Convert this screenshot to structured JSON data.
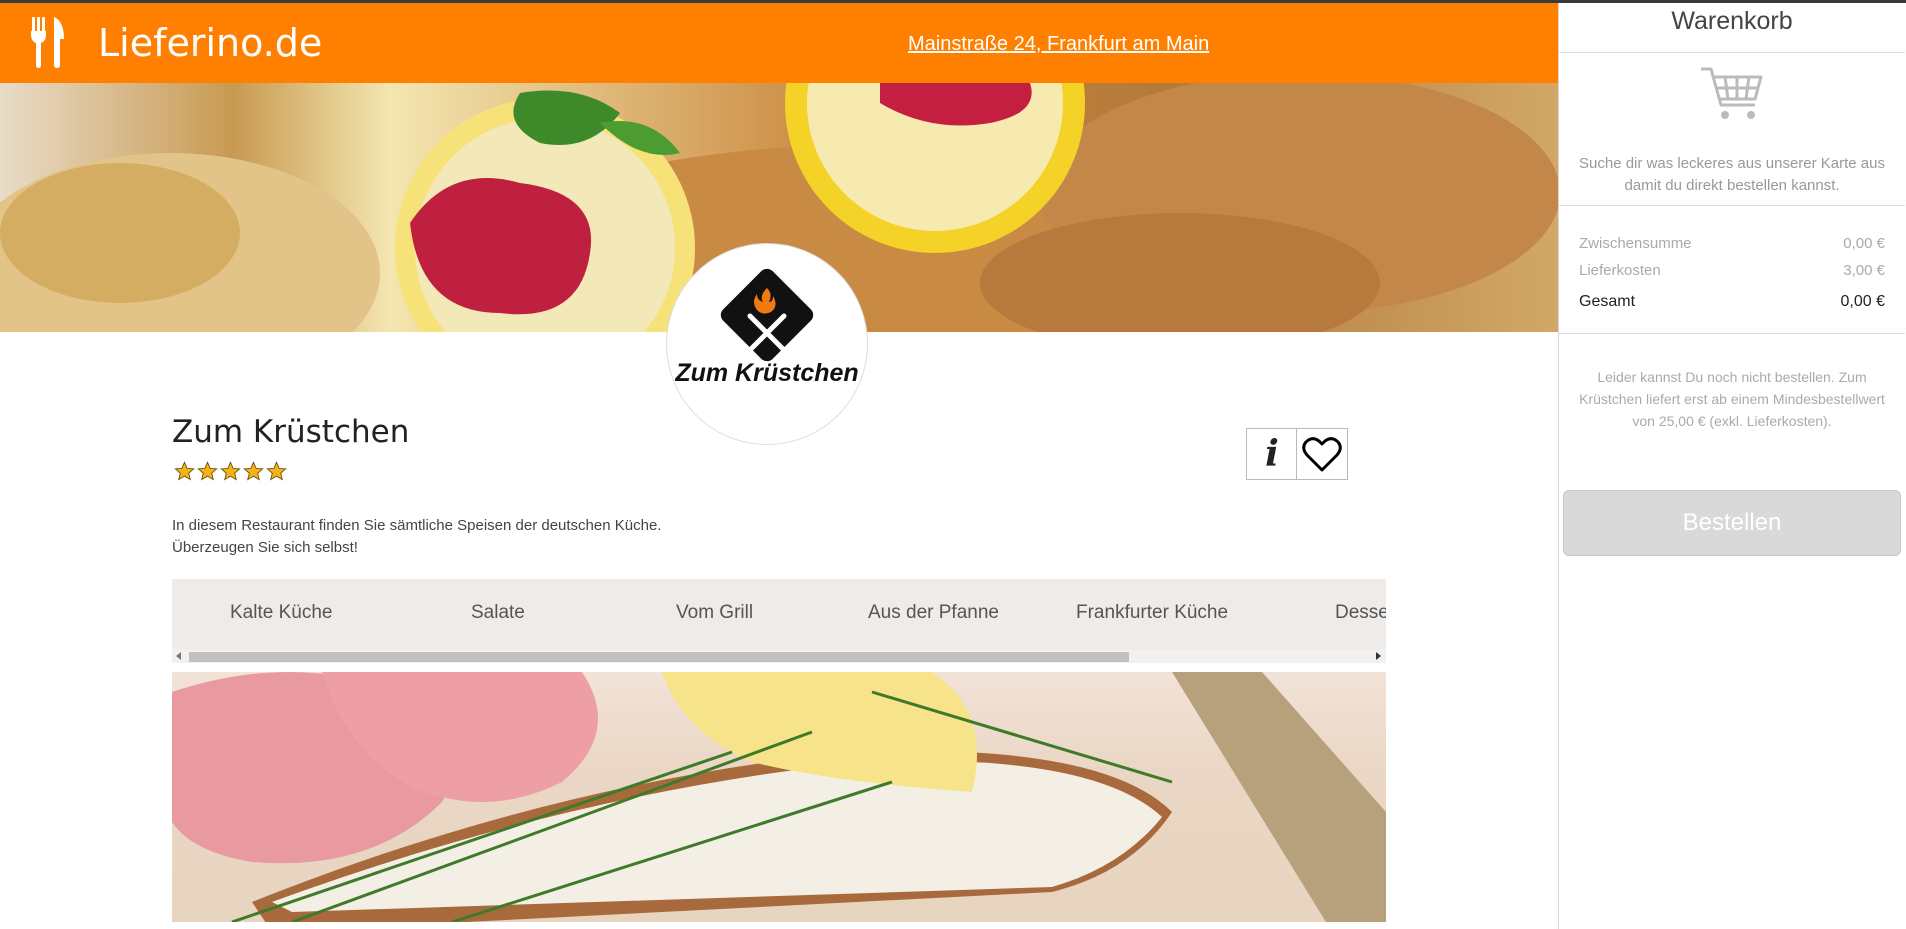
{
  "header": {
    "site_name": "Lieferino.de",
    "address": "Mainstraße 24, Frankfurt am Main",
    "brand_color": "#ff8000"
  },
  "restaurant": {
    "logo_text": "Zum Krüstchen",
    "name": "Zum Krüstchen",
    "rating": 5,
    "rating_max": 5,
    "description_line1": "In diesem Restaurant finden Sie sämtliche Speisen der deutschen Küche.",
    "description_line2": "Überzeugen Sie sich selbst!",
    "info_icon": "info-icon",
    "info_label": "i",
    "favorite_icon": "heart-icon"
  },
  "categories": [
    {
      "label": "Kalte Küche"
    },
    {
      "label": "Salate"
    },
    {
      "label": "Vom Grill"
    },
    {
      "label": "Aus der Pfanne"
    },
    {
      "label": "Frankfurter Küche"
    },
    {
      "label": "Desse"
    }
  ],
  "cart": {
    "title": "Warenkorb",
    "empty_hint": "Suche dir was leckeres aus unserer Karte aus damit du direkt bestellen kannst.",
    "subtotal_label": "Zwischensumme",
    "subtotal_value": "0,00 €",
    "delivery_label": "Lieferkosten",
    "delivery_value": "3,00 €",
    "total_label": "Gesamt",
    "total_value": "0,00 €",
    "min_order_warning": "Leider kannst Du noch nicht bestellen. Zum Krüstchen liefert erst ab einem Mindesbestellwert von 25,00 € (exkl. Lieferkosten).",
    "order_button": "Bestellen"
  }
}
